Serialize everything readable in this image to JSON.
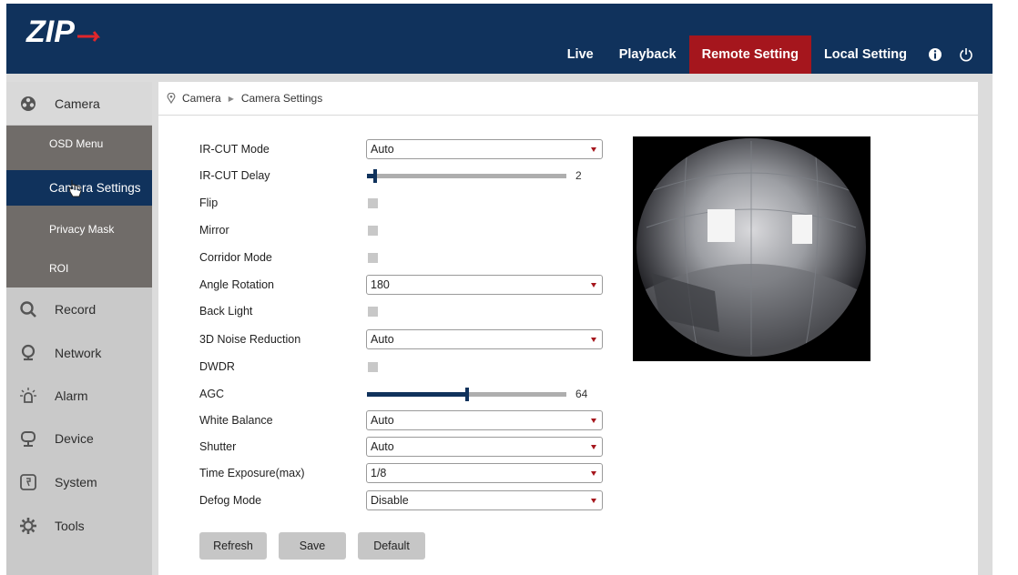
{
  "header": {
    "logo_text": "ZIP",
    "nav": [
      {
        "label": "Live",
        "active": false
      },
      {
        "label": "Playback",
        "active": false
      },
      {
        "label": "Remote Setting",
        "active": true
      },
      {
        "label": "Local Setting",
        "active": false
      }
    ],
    "icons": [
      "info-icon",
      "power-icon"
    ]
  },
  "sidebar": {
    "camera": {
      "label": "Camera",
      "icon": "camera-settings-icon"
    },
    "sub_items": [
      {
        "label": "OSD Menu",
        "active": false
      },
      {
        "label": "Camera Settings",
        "active": true
      },
      {
        "label": "Privacy Mask",
        "active": false
      },
      {
        "label": "ROI",
        "active": false
      }
    ],
    "items": [
      {
        "label": "Record",
        "icon": "search-icon"
      },
      {
        "label": "Network",
        "icon": "location-pin-icon"
      },
      {
        "label": "Alarm",
        "icon": "alarm-bulb-icon"
      },
      {
        "label": "Device",
        "icon": "monitor-icon"
      },
      {
        "label": "System",
        "icon": "system-icon"
      },
      {
        "label": "Tools",
        "icon": "gear-icon"
      }
    ]
  },
  "breadcrumb": {
    "root": "Camera",
    "current": "Camera Settings"
  },
  "form": {
    "ir_cut_mode": {
      "label": "IR-CUT Mode",
      "value": "Auto"
    },
    "ir_cut_delay": {
      "label": "IR-CUT Delay",
      "value": "2",
      "fraction": 0.04
    },
    "flip": {
      "label": "Flip",
      "checked": false
    },
    "mirror": {
      "label": "Mirror",
      "checked": false
    },
    "corridor_mode": {
      "label": "Corridor Mode",
      "checked": false
    },
    "angle_rotation": {
      "label": "Angle Rotation",
      "value": "180"
    },
    "back_light": {
      "label": "Back Light",
      "checked": false
    },
    "noise_reduction": {
      "label": "3D Noise Reduction",
      "value": "Auto"
    },
    "dwdr": {
      "label": "DWDR",
      "checked": false
    },
    "agc": {
      "label": "AGC",
      "value": "64",
      "fraction": 0.5
    },
    "white_balance": {
      "label": "White Balance",
      "value": "Auto"
    },
    "shutter": {
      "label": "Shutter",
      "value": "Auto"
    },
    "time_exposure": {
      "label": "Time Exposure(max)",
      "value": "1/8"
    },
    "defog_mode": {
      "label": "Defog Mode",
      "value": "Disable"
    }
  },
  "buttons": {
    "refresh": "Refresh",
    "save": "Save",
    "default": "Default"
  },
  "colors": {
    "header": "#10325c",
    "accent": "#a5161d",
    "sidebar": "#c9c9c9",
    "sub_panel": "#706c69"
  }
}
